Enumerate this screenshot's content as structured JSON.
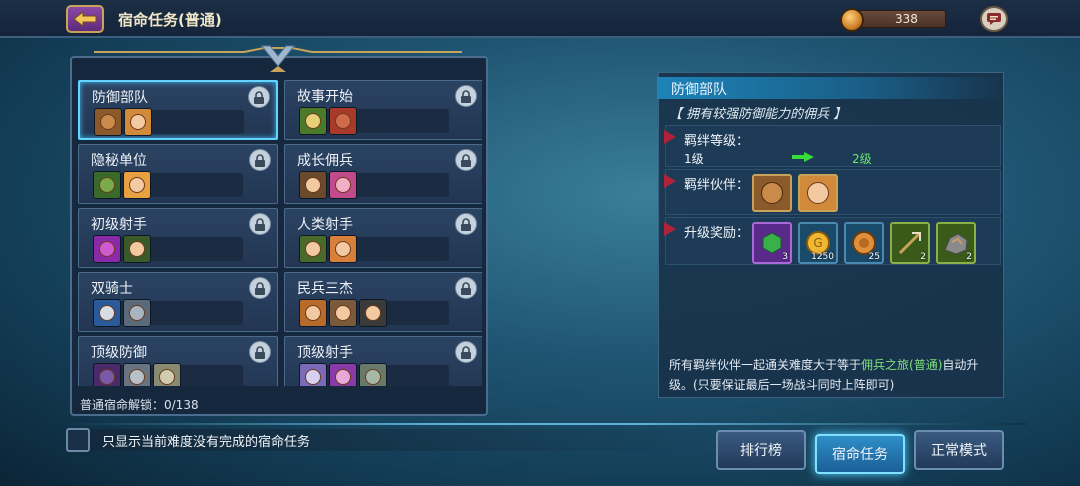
{
  "header": {
    "title": "宿命任务(普通)",
    "gold_amount": "338"
  },
  "tasks": [
    {
      "name": "防御部队",
      "selected": true
    },
    {
      "name": "故事开始",
      "selected": false
    },
    {
      "name": "隐秘单位",
      "selected": false
    },
    {
      "name": "成长佣兵",
      "selected": false
    },
    {
      "name": "初级射手",
      "selected": false
    },
    {
      "name": "人类射手",
      "selected": false
    },
    {
      "name": "双骑士",
      "selected": false
    },
    {
      "name": "民兵三杰",
      "selected": false
    },
    {
      "name": "顶级防御",
      "selected": false
    },
    {
      "name": "顶级射手",
      "selected": false
    }
  ],
  "unlock_status": "普通宿命解锁：0/138",
  "filter": {
    "label": "只显示当前难度没有完成的宿命任务",
    "checked": false
  },
  "detail": {
    "title": "防御部队",
    "description": "【 拥有较强防御能力的佣兵 】",
    "level_label": "羁绊等级：",
    "level_from": "1级",
    "level_to": "2级",
    "partners_label": "羁绊伙伴：",
    "rewards_label": "升级奖励：",
    "rewards": [
      {
        "icon": "green-gem-icon",
        "count": "3"
      },
      {
        "icon": "gold-coin-icon",
        "count": "1250"
      },
      {
        "icon": "bronze-coin-icon",
        "count": "25"
      },
      {
        "icon": "crossbow-part-icon",
        "count": "2"
      },
      {
        "icon": "ore-icon",
        "count": "2"
      }
    ],
    "note_before": "所有羁绊伙伴一起通关难度大于等于",
    "note_highlight": "佣兵之旅(普通)",
    "note_after": "自动升级。(只要保证最后一场战斗同时上阵即可)"
  },
  "buttons": {
    "ranking": "排行榜",
    "fate_task": "宿命任务",
    "normal_mode": "正常模式"
  },
  "colors": {
    "selected_border": "#62d4ff",
    "level_to": "#6ee26e",
    "accent_active": "#2f8fc8"
  }
}
